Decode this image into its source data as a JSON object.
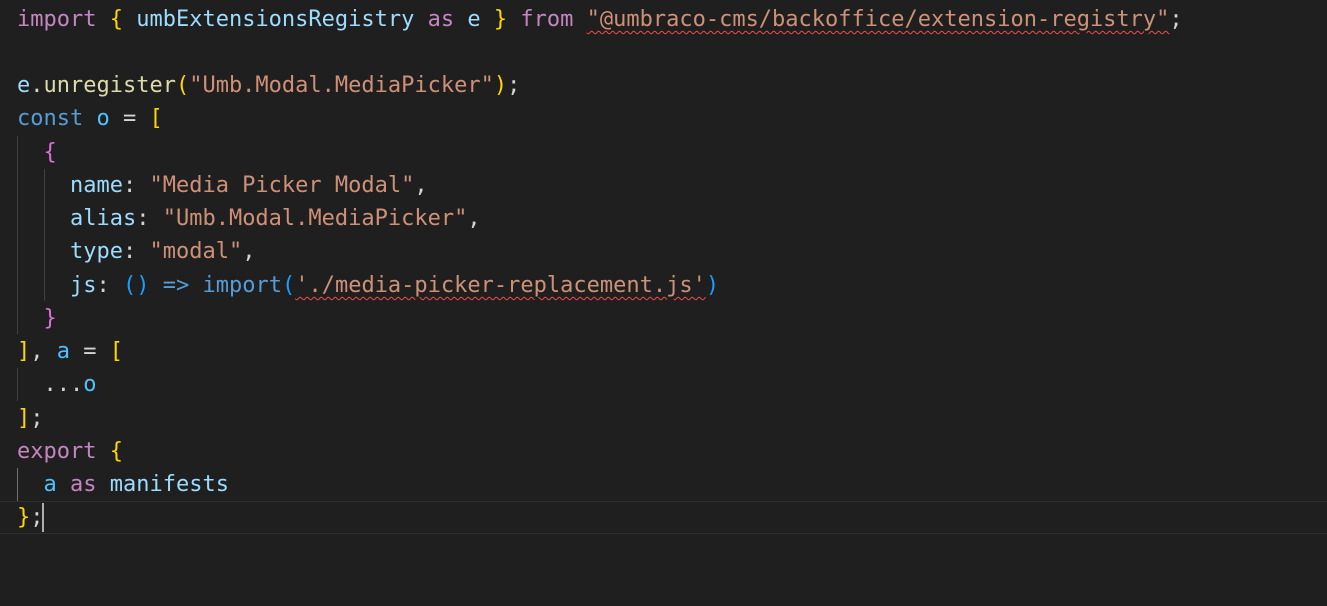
{
  "code": {
    "line1": {
      "import_kw": "import",
      "open_brace": "{",
      "registry_name": "umbExtensionsRegistry",
      "as_kw": "as",
      "alias_e": "e",
      "close_brace": "}",
      "from_kw": "from",
      "module_path": "\"@umbraco-cms/backoffice/extension-registry\"",
      "semicolon": ";"
    },
    "line3": {
      "obj": "e",
      "dot": ".",
      "method": "unregister",
      "open_paren": "(",
      "arg": "\"Umb.Modal.MediaPicker\"",
      "close_paren": ")",
      "semicolon": ";"
    },
    "line4": {
      "const_kw": "const",
      "var_o": "o",
      "equals": "=",
      "open_bracket": "["
    },
    "line5": {
      "open_brace": "{"
    },
    "line6": {
      "key": "name",
      "colon": ":",
      "value": "\"Media Picker Modal\"",
      "comma": ","
    },
    "line7": {
      "key": "alias",
      "colon": ":",
      "value": "\"Umb.Modal.MediaPicker\"",
      "comma": ","
    },
    "line8": {
      "key": "type",
      "colon": ":",
      "value": "\"modal\"",
      "comma": ","
    },
    "line9": {
      "key": "js",
      "colon": ":",
      "params": "()",
      "arrow": "=>",
      "import_kw": "import",
      "open_paren": "(",
      "path": "'./media-picker-replacement.js'",
      "close_paren": ")"
    },
    "line10": {
      "close_brace": "}"
    },
    "line11": {
      "close_bracket": "]",
      "comma": ",",
      "var_a": "a",
      "equals": "=",
      "open_bracket": "["
    },
    "line12": {
      "spread": "...",
      "var_o": "o"
    },
    "line13": {
      "close_bracket": "]",
      "semicolon": ";"
    },
    "line14": {
      "export_kw": "export",
      "open_brace": "{"
    },
    "line15": {
      "var_a": "a",
      "as_kw": "as",
      "export_name": "manifests"
    },
    "line16": {
      "close_brace": "}",
      "semicolon": ";"
    }
  },
  "colors": {
    "background": "#1f1f1f",
    "keyword_control": "#c586c0",
    "keyword": "#569cd6",
    "variable": "#9cdcfe",
    "constant": "#4fc1ff",
    "function": "#dcdcaa",
    "string": "#ce9178",
    "bracket_level1": "#ffd700",
    "bracket_level2": "#da70d6",
    "bracket_level3": "#179fff",
    "error_squiggle": "#f14c4c"
  }
}
